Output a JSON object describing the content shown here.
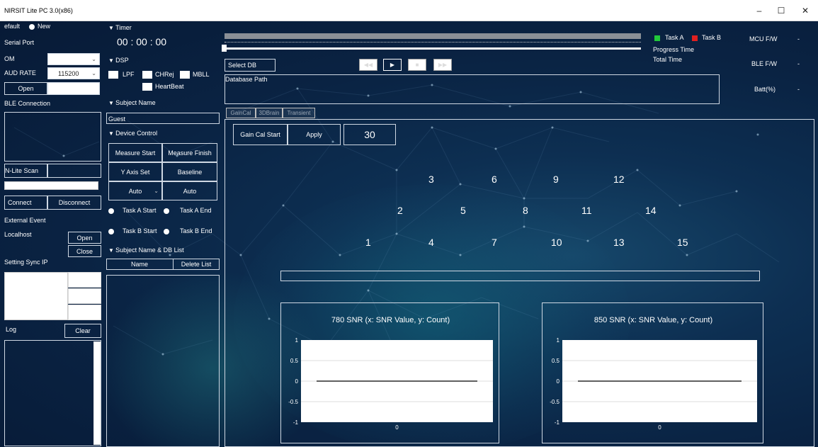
{
  "window": {
    "title": "NIRSIT Lite PC 3.0(x86)",
    "minimize": "–",
    "maximize": "☐",
    "close": "✕"
  },
  "left": {
    "mode_default": "efault",
    "mode_new": "New",
    "serial_port": "Serial Port",
    "com_label": "OM",
    "baud_label": "AUD RATE",
    "baud_value": "115200",
    "open_button": "Open",
    "ble_connection": "BLE Connection",
    "nlite_scan": "N-Lite Scan",
    "connect": "Connect",
    "disconnect": "Disconnect",
    "external_event": "External Event",
    "localhost": "Localhost",
    "ext_open": "Open",
    "ext_close": "Close",
    "setting_sync_ip": "Setting Sync IP",
    "log": "Log",
    "clear": "Clear"
  },
  "middle": {
    "timer_header": "Timer",
    "timer_value": "00 : 00 : 00",
    "dsp_header": "DSP",
    "lpf": "LPF",
    "chrej": "CHRej",
    "mbll": "MBLL",
    "heartbeat": "HeartBeat",
    "subject_name_header": "Subject Name",
    "subject_name_value": "Guest",
    "device_control_header": "Device Control",
    "measure_start": "Measure Start",
    "measure_finish": "Measure Finish",
    "y_axis_set": "Y Axis Set",
    "baseline": "Baseline",
    "auto_combo": "Auto",
    "auto_button": "Auto",
    "task_a_start": "Task A Start",
    "task_a_end": "Task A End",
    "task_b_start": "Task B Start",
    "task_b_end": "Task B End",
    "subject_db_header": "Subject Name & DB List",
    "name_col": "Name",
    "delete_list": "Delete List"
  },
  "top": {
    "task_a": "Task A",
    "task_b": "Task B",
    "task_a_color": "#22c93a",
    "task_b_color": "#e02020",
    "progress_time": "Progress Time",
    "total_time": "Total Time",
    "select_db": "Select DB",
    "database_path": "Database Path",
    "mcu_fw": "MCU F/W",
    "mcu_fw_value": "-",
    "ble_fw": "BLE F/W",
    "ble_fw_value": "-",
    "batt": "Batt(%)",
    "batt_value": "-"
  },
  "tabs": [
    "GainCal",
    "3DBrain",
    "Transient"
  ],
  "gaincal": {
    "start": "Gain Cal Start",
    "apply": "Apply",
    "value": "30",
    "channels": [
      "1",
      "2",
      "3",
      "4",
      "5",
      "6",
      "7",
      "8",
      "9",
      "10",
      "11",
      "12",
      "13",
      "14",
      "15"
    ]
  },
  "chart_data": [
    {
      "type": "line",
      "title": "780 SNR (x: SNR Value, y: Count)",
      "x": [
        0
      ],
      "series": [
        {
          "values": [
            0
          ]
        }
      ],
      "ylim": [
        -1,
        1
      ],
      "yticks": [
        "1",
        "0.5",
        "0",
        "-0.5",
        "-1"
      ],
      "xticks": [
        "0"
      ]
    },
    {
      "type": "line",
      "title": "850 SNR (x: SNR Value, y: Count)",
      "x": [
        0
      ],
      "series": [
        {
          "values": [
            0
          ]
        }
      ],
      "ylim": [
        -1,
        1
      ],
      "yticks": [
        "1",
        "0.5",
        "0",
        "-0.5",
        "-1"
      ],
      "xticks": [
        "0"
      ]
    }
  ]
}
